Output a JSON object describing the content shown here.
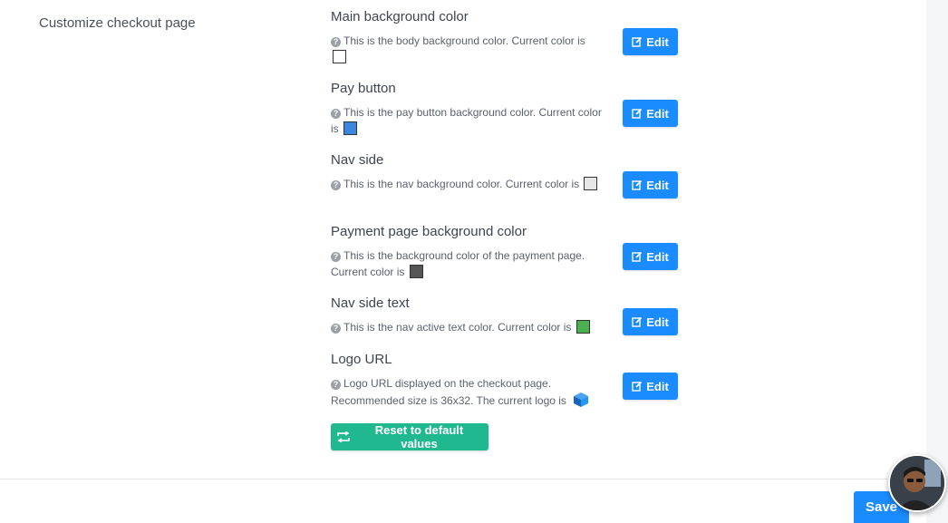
{
  "page": {
    "section_title": "Customize checkout page",
    "edit_label": "Edit",
    "reset_label": "Reset to default values",
    "save_label": "Save"
  },
  "settings": [
    {
      "label": "Main background color",
      "desc": "This is the body background color. Current color is",
      "color": "#ffffff"
    },
    {
      "label": "Pay button",
      "desc": "This is the pay button background color. Current color is",
      "color": "#3c86e0"
    },
    {
      "label": "Nav side",
      "desc": "This is the nav background color. Current color is",
      "color": "#e6e6e6"
    },
    {
      "label": "Payment page background color",
      "desc": "This is the background color of the payment page. Current color is",
      "color": "#555555"
    },
    {
      "label": "Nav side text",
      "desc": "This is the nav active text color. Current color is",
      "color": "#4caf50"
    },
    {
      "label": "Logo URL",
      "desc": "Logo URL displayed on the checkout page. Recommended size is 36x32. The current logo is",
      "icon": "cube-logo-icon"
    }
  ],
  "colors": {
    "primary": "#1a8cff",
    "reset": "#1fb88f"
  }
}
